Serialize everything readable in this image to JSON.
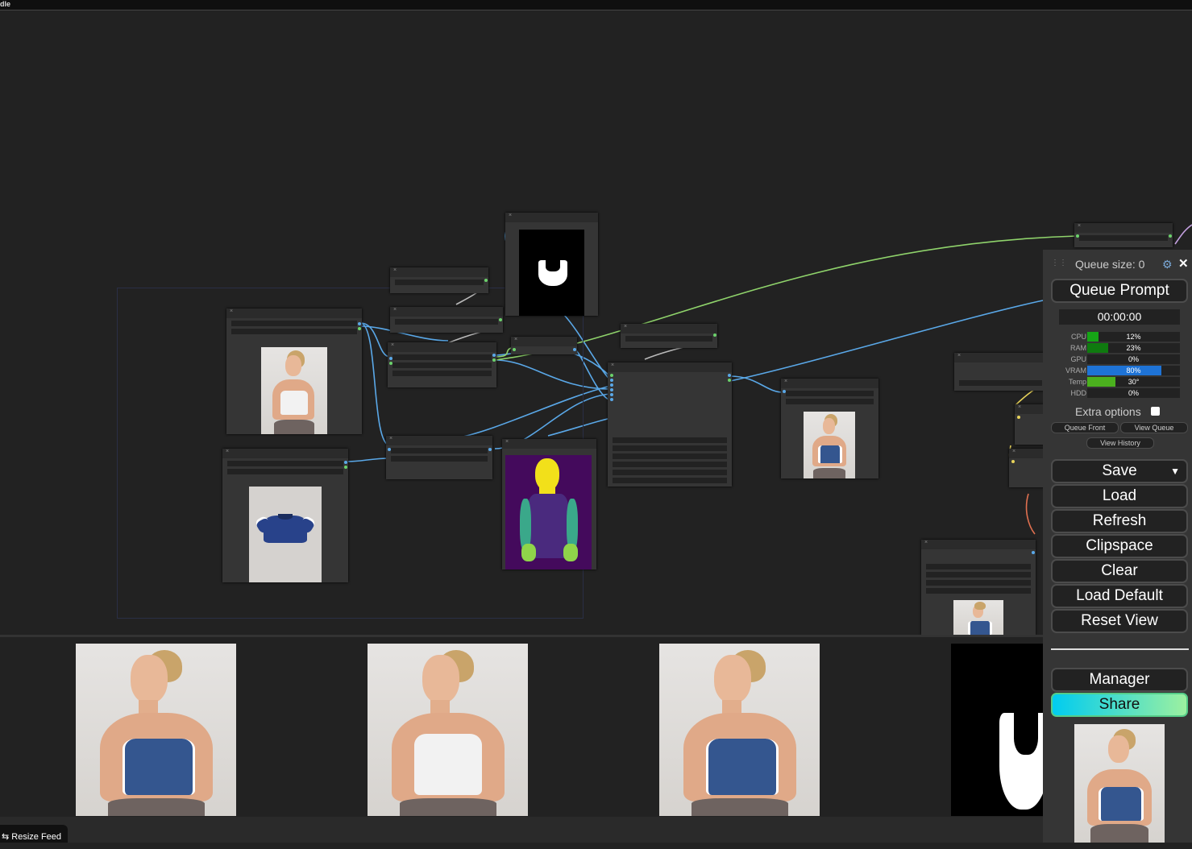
{
  "window": {
    "title_fragment": "dle"
  },
  "queue": {
    "size_label": "Queue size: 0",
    "queue_prompt": "Queue Prompt",
    "timer": "00:00:00",
    "stats": [
      {
        "label": "CPU",
        "value": "12%",
        "fill": 0.12,
        "color": "#16a516"
      },
      {
        "label": "RAM",
        "value": "23%",
        "fill": 0.23,
        "color": "#0f7a0f"
      },
      {
        "label": "GPU",
        "value": "0%",
        "fill": 0.0,
        "color": "#16a516"
      },
      {
        "label": "VRAM",
        "value": "80%",
        "fill": 0.8,
        "color": "#1e73d6"
      },
      {
        "label": "Temp",
        "value": "30°",
        "fill": 0.3,
        "color": "#4bb01e"
      },
      {
        "label": "HDD",
        "value": "0%",
        "fill": 0.0,
        "color": "#16a516"
      }
    ],
    "extra_options": "Extra options",
    "queue_front": "Queue Front",
    "view_queue": "View Queue",
    "view_history": "View History",
    "save": "Save",
    "save_arrow": "▼",
    "load": "Load",
    "refresh": "Refresh",
    "clipspace": "Clipspace",
    "clear": "Clear",
    "load_default": "Load Default",
    "reset_view": "Reset View",
    "manager": "Manager",
    "share": "Share"
  },
  "icons": {
    "gear": "⚙",
    "close": "✕",
    "grip": "⋮⋮",
    "resize": "⇆"
  },
  "feed": {
    "resize_label": "Resize Feed"
  }
}
